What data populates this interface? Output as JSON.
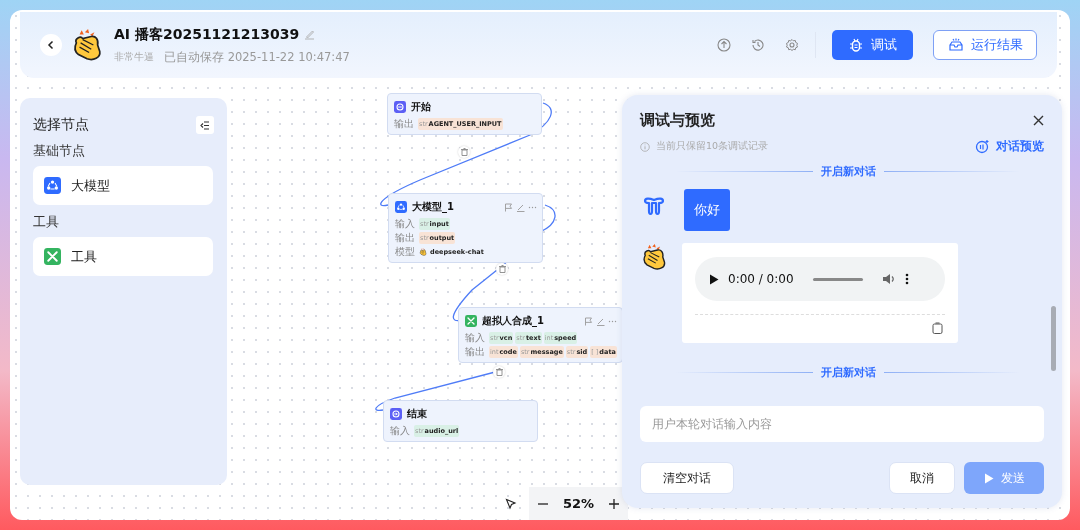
{
  "header": {
    "title": "AI 播客20251121213039",
    "author": "非常牛逼",
    "saved": "已自动保存 2025-11-22 10:47:47",
    "debug_button": "调试",
    "results_button": "运行结果"
  },
  "sidebar": {
    "title": "选择节点",
    "sections": [
      {
        "title": "基础节点",
        "items": [
          {
            "label": "大模型",
            "kind": "llm"
          }
        ]
      },
      {
        "title": "工具",
        "items": [
          {
            "label": "工具",
            "kind": "tool"
          }
        ]
      }
    ]
  },
  "canvas": {
    "nodes": [
      {
        "kind": "start",
        "title": "开始",
        "actions": false,
        "rows": [
          {
            "kind": "output",
            "label": "输出",
            "params": [
              {
                "type": "str",
                "name": "AGENT_USER_INPUT"
              }
            ]
          }
        ]
      },
      {
        "kind": "llm",
        "title": "大模型_1",
        "actions": true,
        "rows": [
          {
            "kind": "input",
            "label": "输入",
            "params": [
              {
                "type": "str",
                "name": "input"
              }
            ]
          },
          {
            "kind": "output",
            "label": "输出",
            "params": [
              {
                "type": "str",
                "name": "output"
              }
            ]
          },
          {
            "kind": "model",
            "label": "模型",
            "params": [
              {
                "name": "deepseek-chat"
              }
            ]
          }
        ]
      },
      {
        "kind": "tool",
        "title": "超拟人合成_1",
        "actions": true,
        "rows": [
          {
            "kind": "input",
            "label": "输入",
            "params": [
              {
                "type": "str",
                "name": "vcn"
              },
              {
                "type": "str",
                "name": "text"
              },
              {
                "type": "int",
                "name": "speed"
              }
            ]
          },
          {
            "kind": "output",
            "label": "输出",
            "params": [
              {
                "type": "int",
                "name": "code"
              },
              {
                "type": "str",
                "name": "message"
              },
              {
                "type": "str",
                "name": "sid"
              },
              {
                "type": "[ ]",
                "name": "data"
              }
            ]
          }
        ]
      },
      {
        "kind": "end",
        "title": "结束",
        "actions": false,
        "rows": [
          {
            "kind": "input",
            "label": "输入",
            "params": [
              {
                "type": "str",
                "name": "audio_url"
              }
            ]
          }
        ]
      }
    ],
    "zoom": "52%"
  },
  "panel": {
    "title": "调试与预览",
    "note": "当前只保留10条调试记录",
    "preview_link": "对话预览",
    "messages": [
      {
        "kind": "divider",
        "text": "开启新对话"
      },
      {
        "kind": "user",
        "text": "你好"
      },
      {
        "kind": "audio",
        "text": "0:00 / 0:00"
      },
      {
        "kind": "divider",
        "text": "开启新对话"
      }
    ],
    "input": {
      "placeholder": "用户本轮对话输入内容"
    },
    "clear_button": "清空对话",
    "cancel_button": "取消",
    "send_button": {
      "label": "发送",
      "disabled": true
    }
  }
}
